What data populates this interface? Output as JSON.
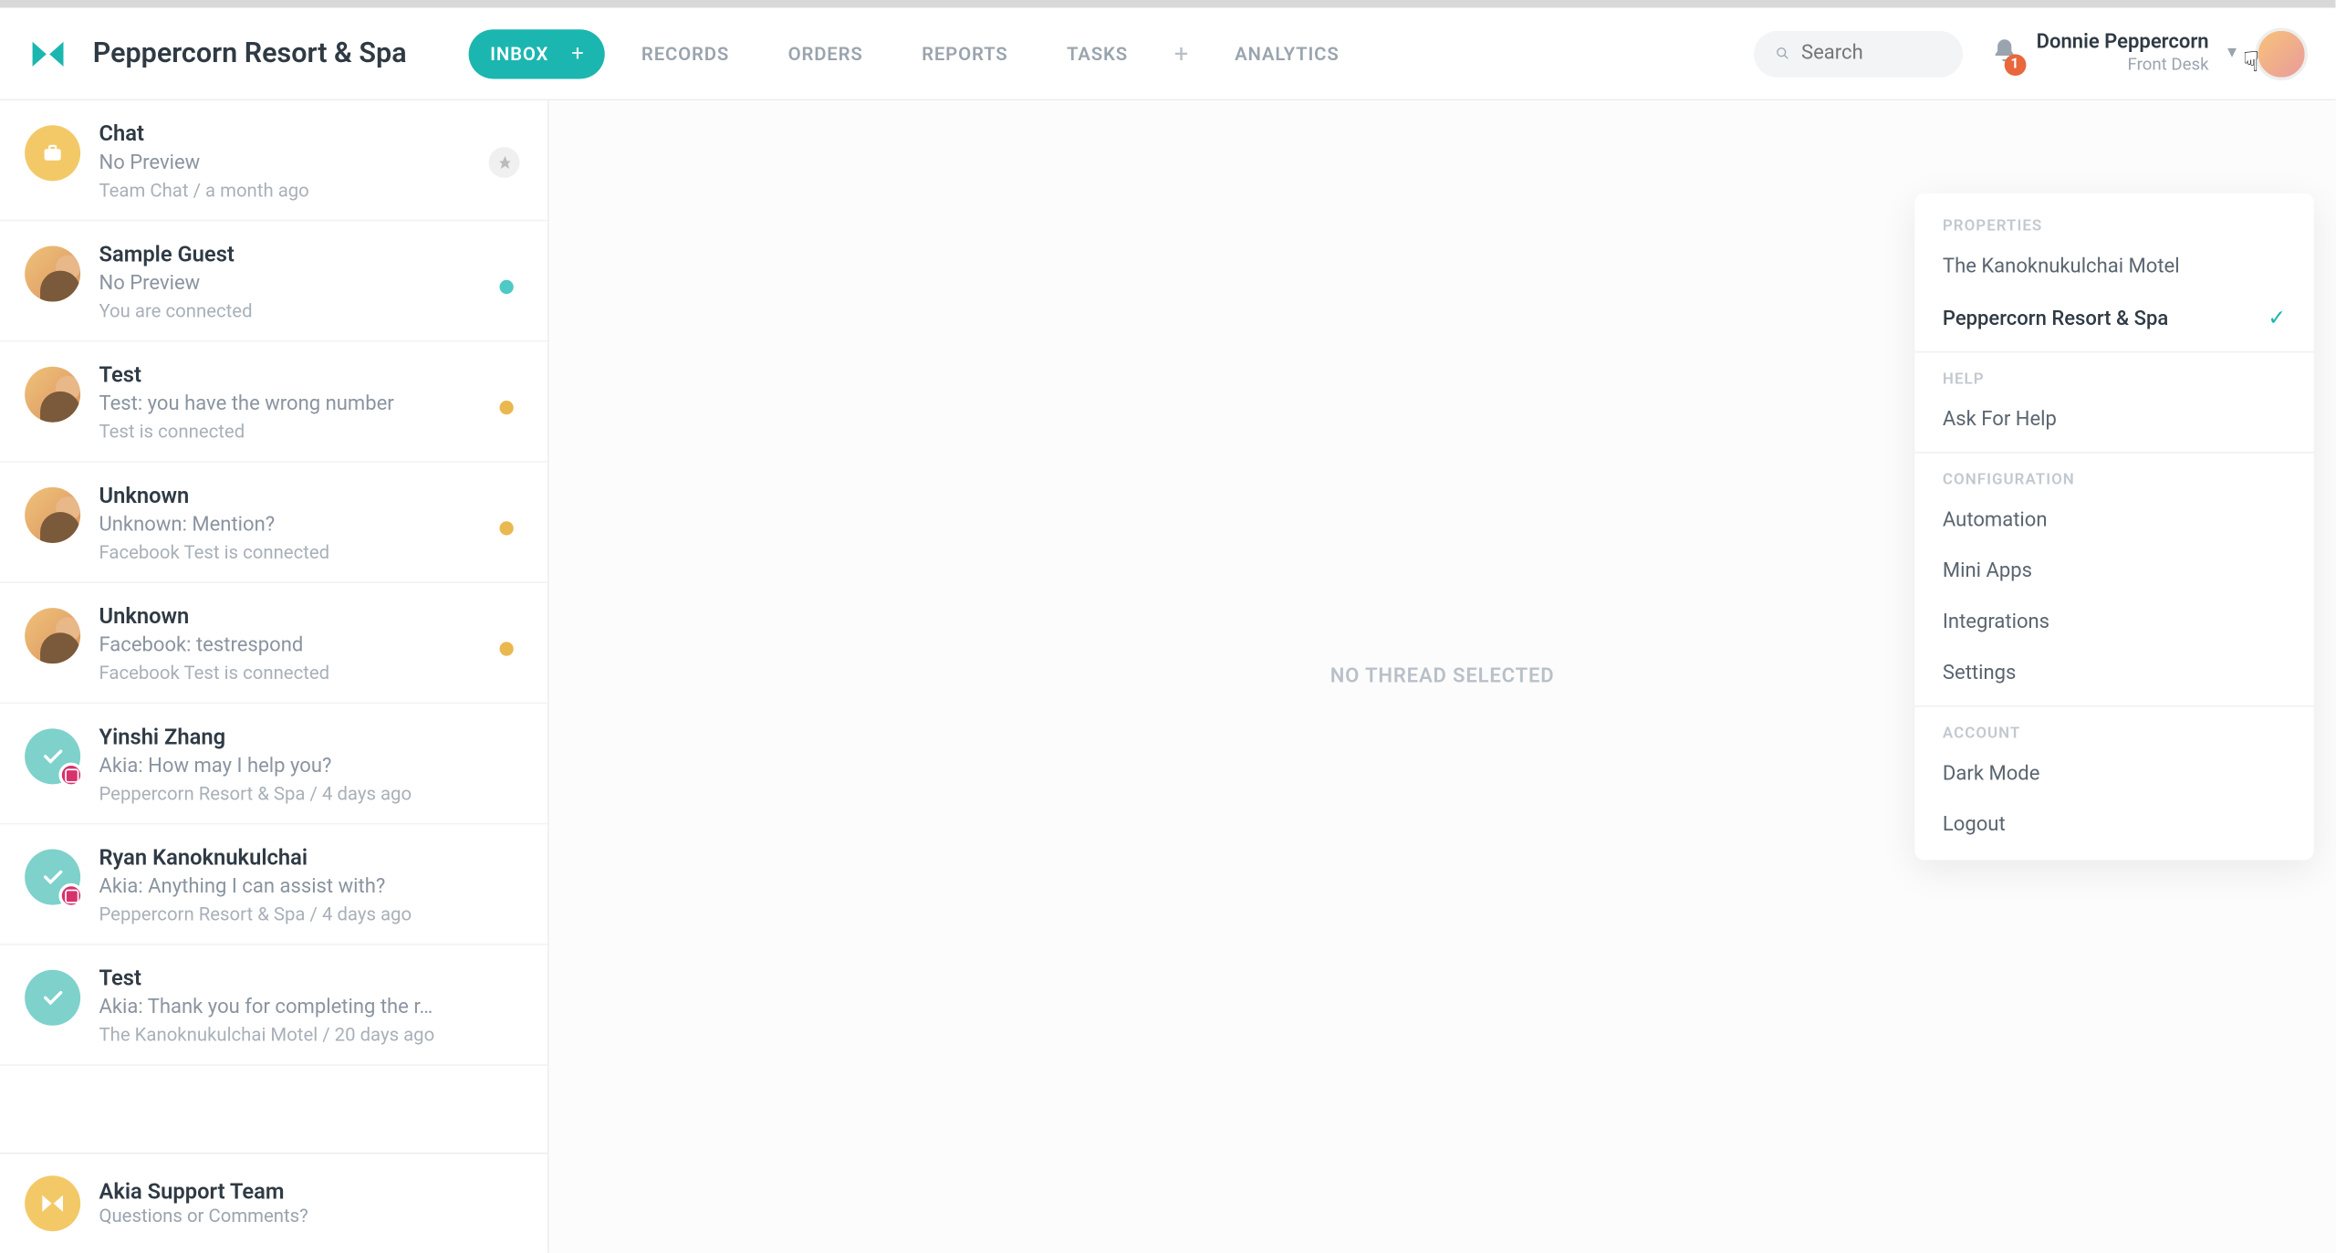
{
  "brand": "Peppercorn Resort & Spa",
  "nav": {
    "inbox": "INBOX",
    "records": "RECORDS",
    "orders": "ORDERS",
    "reports": "REPORTS",
    "tasks": "TASKS",
    "analytics": "ANALYTICS"
  },
  "search": {
    "placeholder": "Search"
  },
  "notifications": {
    "count": "1"
  },
  "user": {
    "name": "Donnie Peppercorn",
    "role": "Front Desk"
  },
  "threads": [
    {
      "title": "Chat",
      "preview": "No Preview",
      "meta": "Team Chat / a month ago",
      "avatar": "briefcase",
      "indicator": "pin"
    },
    {
      "title": "Sample Guest",
      "preview": "No Preview",
      "meta": "You are connected",
      "avatar": "person",
      "indicator": "teal"
    },
    {
      "title": "Test",
      "preview": "Test: you have the wrong number",
      "meta": "Test is connected",
      "avatar": "person",
      "indicator": "amber"
    },
    {
      "title": "Unknown",
      "preview": "Unknown: Mention?",
      "meta": "Facebook Test is connected",
      "avatar": "person",
      "badge": "ig",
      "indicator": "amber"
    },
    {
      "title": "Unknown",
      "preview": "Facebook: testrespond",
      "meta": "Facebook Test is connected",
      "avatar": "person",
      "badge": "ig",
      "indicator": "amber"
    },
    {
      "title": "Yinshi Zhang",
      "preview": "Akia: How may I help you?",
      "meta": "Peppercorn Resort & Spa / 4 days ago",
      "avatar": "check",
      "badge": "ig"
    },
    {
      "title": "Ryan Kanoknukulchai",
      "preview": "Akia: Anything I can assist with?",
      "meta": "Peppercorn Resort & Spa / 4 days ago",
      "avatar": "check",
      "badge": "ig"
    },
    {
      "title": "Test",
      "preview": "Akia: Thank you for completing the r…",
      "meta": "The Kanoknukulchai Motel / 20 days ago",
      "avatar": "check"
    }
  ],
  "support": {
    "title": "Akia Support Team",
    "sub": "Questions or Comments?"
  },
  "main": {
    "empty": "NO THREAD SELECTED"
  },
  "dropdown": {
    "sections": {
      "properties_label": "PROPERTIES",
      "help_label": "HELP",
      "configuration_label": "CONFIGURATION",
      "account_label": "ACCOUNT"
    },
    "properties": [
      {
        "label": "The Kanoknukulchai Motel",
        "selected": false
      },
      {
        "label": "Peppercorn Resort & Spa",
        "selected": true
      }
    ],
    "help": [
      {
        "label": "Ask For Help"
      }
    ],
    "configuration": [
      {
        "label": "Automation"
      },
      {
        "label": "Mini Apps"
      },
      {
        "label": "Integrations"
      },
      {
        "label": "Settings"
      }
    ],
    "account": [
      {
        "label": "Dark Mode"
      },
      {
        "label": "Logout"
      }
    ]
  }
}
